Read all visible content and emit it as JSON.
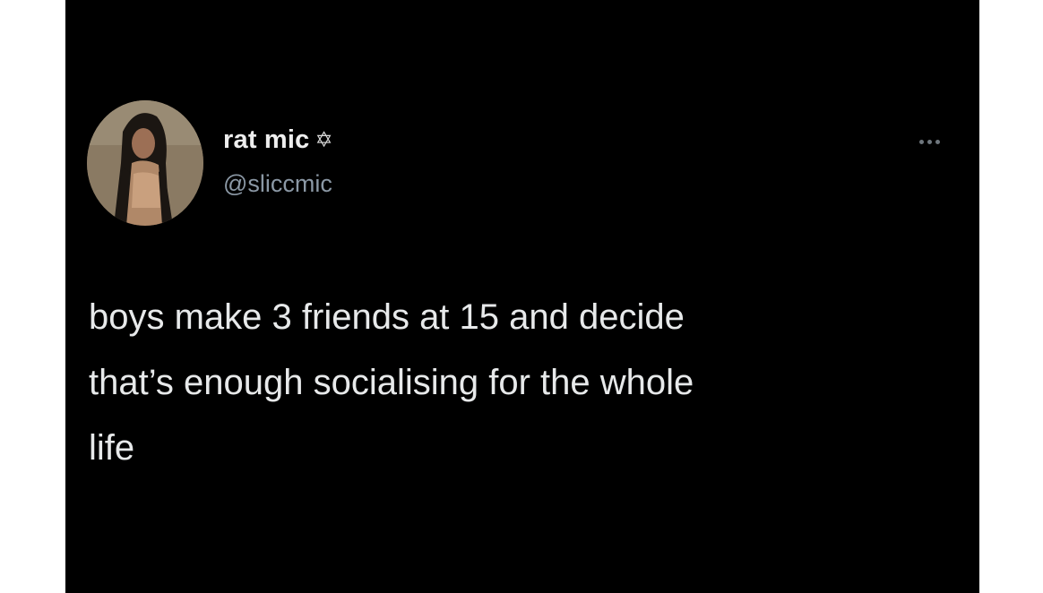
{
  "tweet": {
    "display_name": "rat mic",
    "name_emoji": "✡",
    "handle": "@sliccmic",
    "text": "boys make 3 friends at 15 and decide\nthat’s enough socialising for the whole\nlife"
  },
  "colors": {
    "background": "#000000",
    "text": "#e7e9ea",
    "handle": "#8b98a5",
    "page_margin": "#ffffff"
  },
  "icons": {
    "more": "more-horizontal-icon",
    "avatar": "profile-photo"
  }
}
